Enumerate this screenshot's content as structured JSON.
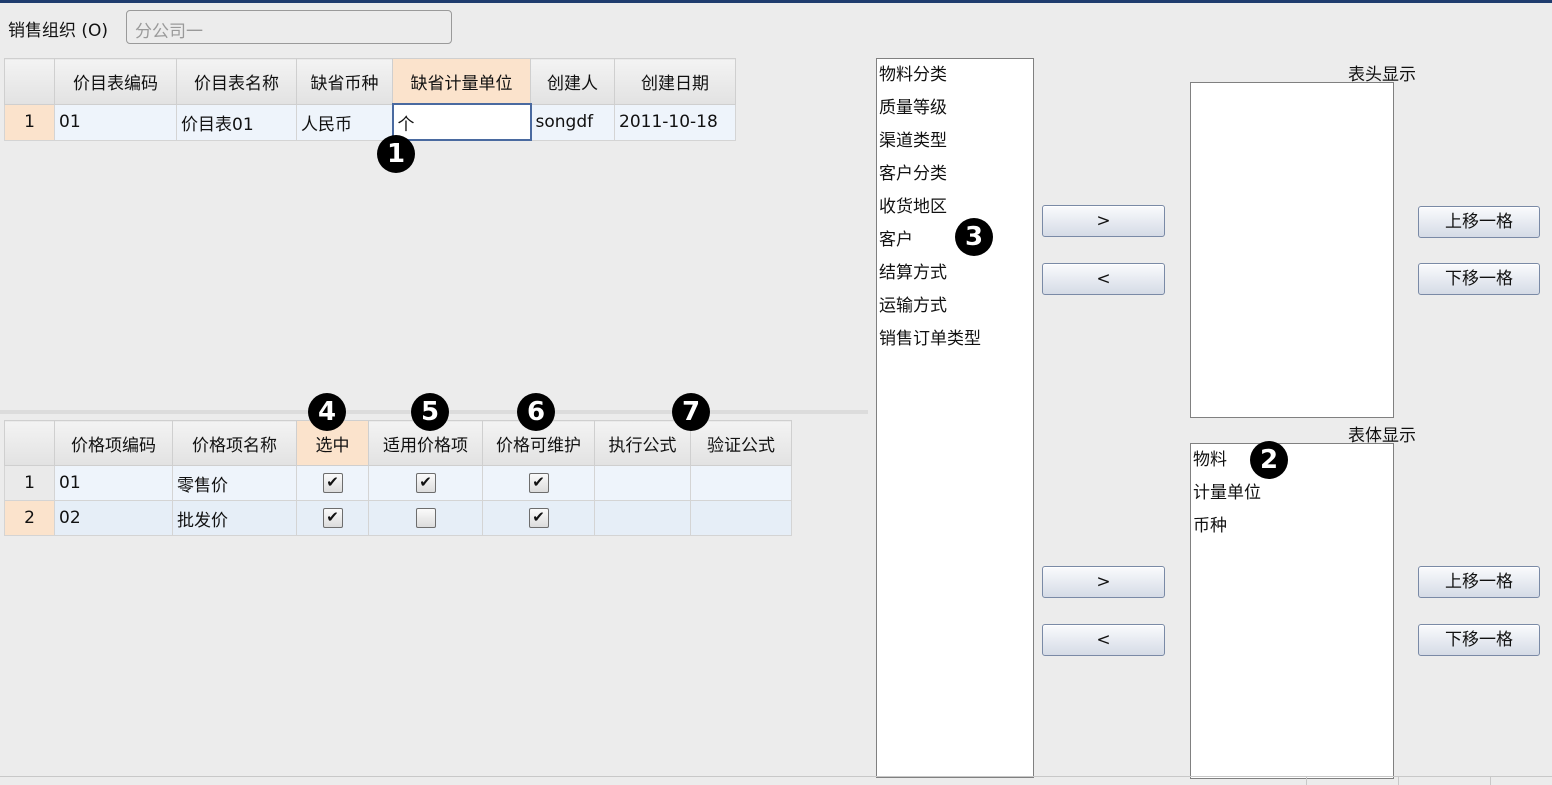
{
  "org": {
    "label": "销售组织 (O)",
    "value": "分公司一"
  },
  "price_table": {
    "columns": [
      "价目表编码",
      "价目表名称",
      "缺省币种",
      "缺省计量单位",
      "创建人",
      "创建日期"
    ],
    "rows": [
      {
        "num": "1",
        "code": "01",
        "name": "价目表01",
        "currency": "人民币",
        "unit": "个",
        "creator": "songdf",
        "date": "2011-10-18"
      }
    ]
  },
  "price_items": {
    "columns": [
      "价格项编码",
      "价格项名称",
      "选中",
      "适用价格项",
      "价格可维护",
      "执行公式",
      "验证公式"
    ],
    "rows": [
      {
        "num": "1",
        "code": "01",
        "name": "零售价",
        "selected": "✔",
        "applicable": "✔",
        "maintainable": "✔",
        "exec": "",
        "verify": ""
      },
      {
        "num": "2",
        "code": "02",
        "name": "批发价",
        "selected": "✔",
        "applicable": "",
        "maintainable": "✔",
        "exec": "",
        "verify": ""
      }
    ]
  },
  "available_dims": [
    "物料分类",
    "质量等级",
    "渠道类型",
    "客户分类",
    "收货地区",
    "客户",
    "结算方式",
    "运输方式",
    "销售订单类型"
  ],
  "header_display": {
    "caption": "表头显示",
    "items": []
  },
  "body_display": {
    "caption": "表体显示",
    "items": [
      "物料",
      "计量单位",
      "币种"
    ]
  },
  "buttons": {
    "add": ">",
    "remove": "<",
    "move_up": "上移一格",
    "move_down": "下移一格"
  },
  "badges": [
    "❶",
    "❷",
    "❸",
    "❹",
    "❺",
    "❻",
    "❼"
  ]
}
